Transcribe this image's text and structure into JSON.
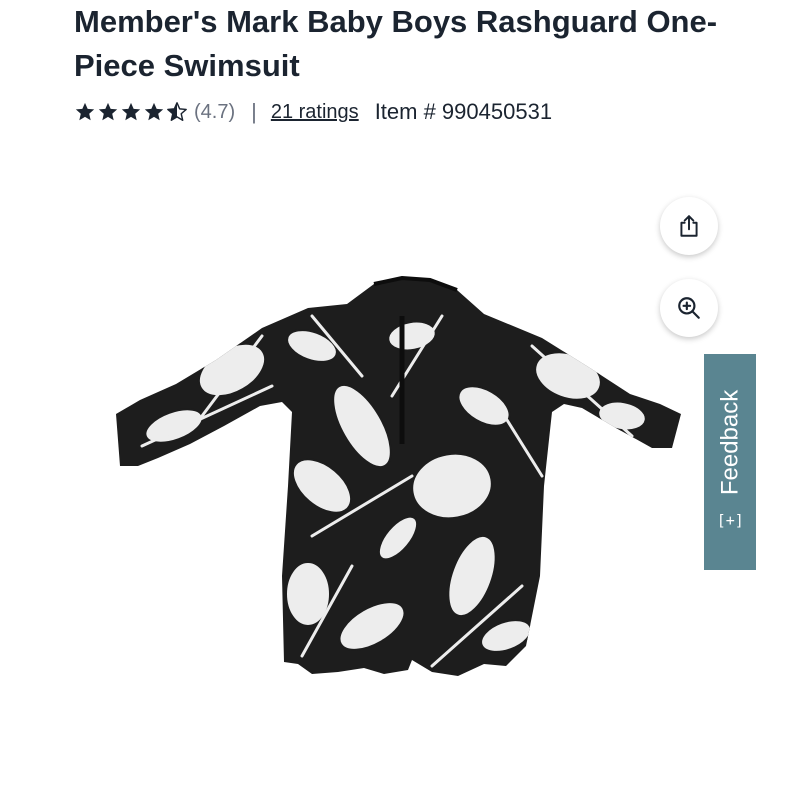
{
  "product": {
    "title": "Member's Mark Baby Boys Rashguard One-Piece Swimsuit",
    "rating_value": "(4.7)",
    "rating": 4.7,
    "separator": "|",
    "ratings_link": "21 ratings",
    "item_number": "Item # 990450531"
  },
  "icons": {
    "share": "share-icon",
    "zoom": "zoom-in-icon",
    "star": "star-icon",
    "feedback": "feedback-plus-icon"
  },
  "feedback": {
    "label": "Feedback",
    "icon_text": "[+]"
  },
  "colors": {
    "title": "#1b2430",
    "muted": "#6b7280",
    "feedback_tab": "#5a8591"
  }
}
